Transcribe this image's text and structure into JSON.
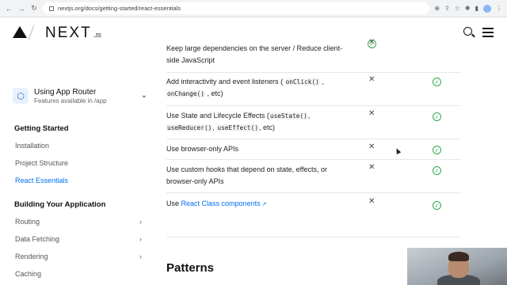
{
  "browser": {
    "url": "nextjs.org/docs/getting-started/react-essentials"
  },
  "header": {
    "logo_text": "NEXT",
    "logo_suffix": ".JS"
  },
  "sidebar": {
    "router_title": "Using App Router",
    "router_subtitle": "Features available in /app",
    "section_getting_started": "Getting Started",
    "items_getting_started": [
      {
        "label": "Installation"
      },
      {
        "label": "Project Structure"
      },
      {
        "label": "React Essentials"
      }
    ],
    "section_building": "Building Your Application",
    "items_building": [
      {
        "label": "Routing"
      },
      {
        "label": "Data Fetching"
      },
      {
        "label": "Rendering"
      },
      {
        "label": "Caching"
      }
    ]
  },
  "table": {
    "rows": [
      {
        "parts": [
          "Keep large dependencies on the server / Reduce client-side JavaScript"
        ],
        "server": "",
        "client": "✓"
      },
      {
        "parts": [
          "Add interactivity and event listeners (",
          "onClick()",
          ",",
          "onChange()",
          ", etc)"
        ]
      },
      {
        "parts": [
          "Use State and Lifecycle Effects (",
          "useState()",
          ",",
          "useReducer()",
          ",",
          "useEffect()",
          ", etc)"
        ]
      },
      {
        "parts": [
          "Use browser-only APIs"
        ]
      },
      {
        "parts": [
          "Use custom hooks that depend on state, effects, or browser-only APIs"
        ]
      },
      {
        "parts": [
          "Use ",
          "React Class components"
        ]
      }
    ],
    "row0_text": "Keep large dependencies on the server / Reduce client-side JavaScript",
    "row1_a": "Add interactivity and event listeners (",
    "row1_code1": "onClick()",
    "row1_b": ",",
    "row1_code2": "onChange()",
    "row1_c": ", etc)",
    "row2_a": "Use State and Lifecycle Effects (",
    "row2_code1": "useState()",
    "row2_b": ",",
    "row2_code2": "useReducer()",
    "row2_c": ",",
    "row2_code3": "useEffect()",
    "row2_d": ", etc)",
    "row3_text": "Use browser-only APIs",
    "row4_text": "Use custom hooks that depend on state, effects, or browser-only APIs",
    "row5_a": "Use",
    "row5_link": "React Class components",
    "cross_glyph": "✕",
    "check_glyph": "✓"
  },
  "section_heading": "Patterns",
  "colors": {
    "accent": "#0070f3",
    "check": "#2fa84f"
  }
}
